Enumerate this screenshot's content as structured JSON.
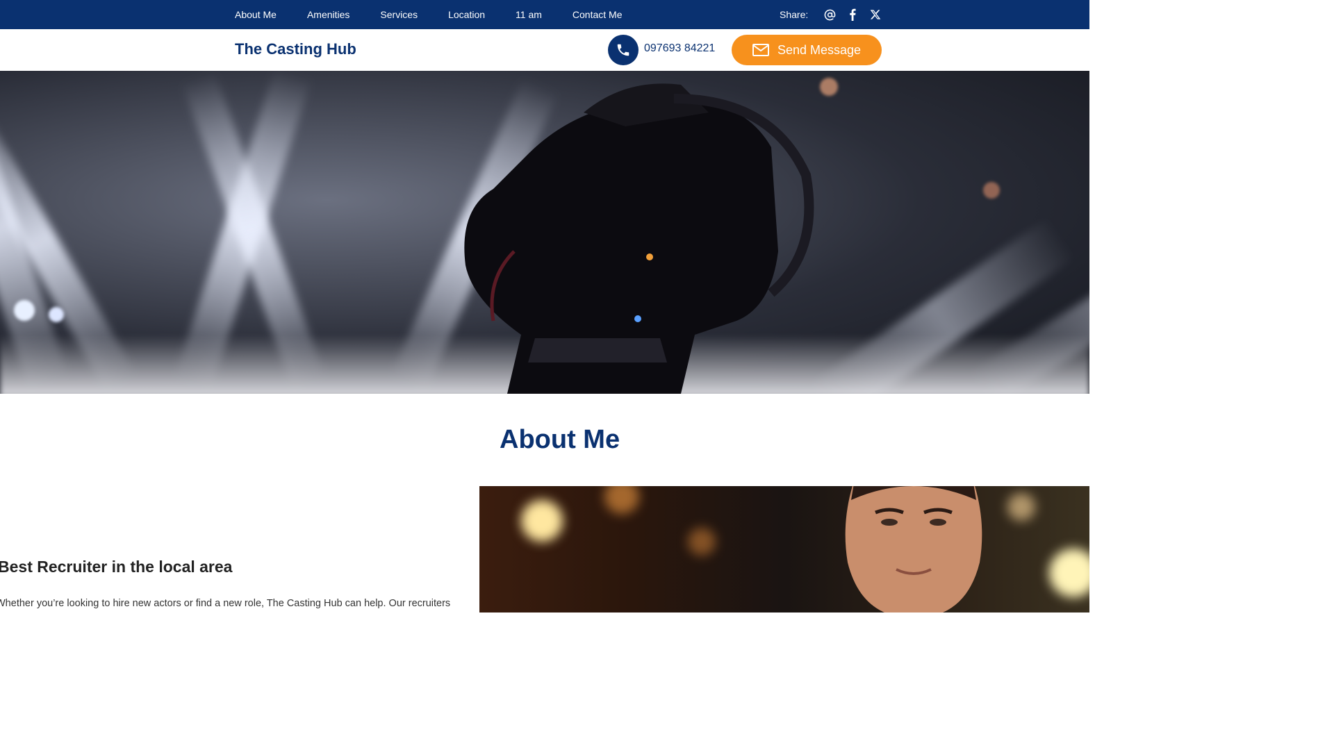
{
  "topbar": {
    "nav_items": [
      "About Me",
      "Amenities",
      "Services",
      "Location",
      "11 am",
      "Contact Me"
    ],
    "share_label": "Share:",
    "share_icons": [
      "at-icon",
      "facebook-icon",
      "x-icon"
    ]
  },
  "header": {
    "brand": "The Casting Hub",
    "phone": "097693 84221",
    "send_button": "Send Message"
  },
  "hero": {
    "image": "camera-silhouette-stage-lights"
  },
  "about": {
    "title": "About Me",
    "subheading": "Best Recruiter in the local area",
    "paragraph": "Whether you’re looking to hire new actors or find a new role, The Casting Hub can help. Our recruiters",
    "portrait": "man-portrait-bokeh"
  },
  "colors": {
    "navy": "#0a3170",
    "accent": "#f7911d",
    "white": "#ffffff"
  }
}
